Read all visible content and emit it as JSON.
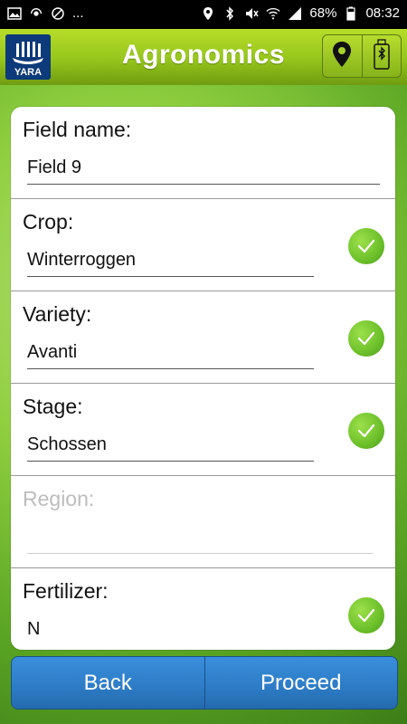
{
  "status_bar": {
    "left_icons": [
      "image-icon",
      "cast-icon",
      "blocked-icon"
    ],
    "more": "...",
    "right_icons": [
      "location-icon",
      "bluetooth-icon",
      "mute-icon",
      "wifi-icon",
      "signal-icon"
    ],
    "battery": "68%",
    "time": "08:32"
  },
  "app_bar": {
    "logo_text": "YARA",
    "title": "Agronomics",
    "buttons": [
      "location-pin-icon",
      "bluetooth-device-icon"
    ]
  },
  "form": {
    "rows": [
      {
        "label": "Field name:",
        "value": "Field 9",
        "checked": false
      },
      {
        "label": "Crop:",
        "value": "Winterroggen",
        "checked": true
      },
      {
        "label": "Variety:",
        "value": "Avanti",
        "checked": true
      },
      {
        "label": "Stage:",
        "value": "Schossen",
        "checked": true
      },
      {
        "label": "Region:",
        "value": "",
        "checked": false,
        "disabled": true
      },
      {
        "label": "Fertilizer:",
        "value": "N",
        "checked": true
      }
    ]
  },
  "actions": {
    "back": "Back",
    "proceed": "Proceed"
  },
  "colors": {
    "appbar": "#95c51c",
    "button_blue": "#2d7bc5",
    "check_green": "#6cc02a"
  }
}
